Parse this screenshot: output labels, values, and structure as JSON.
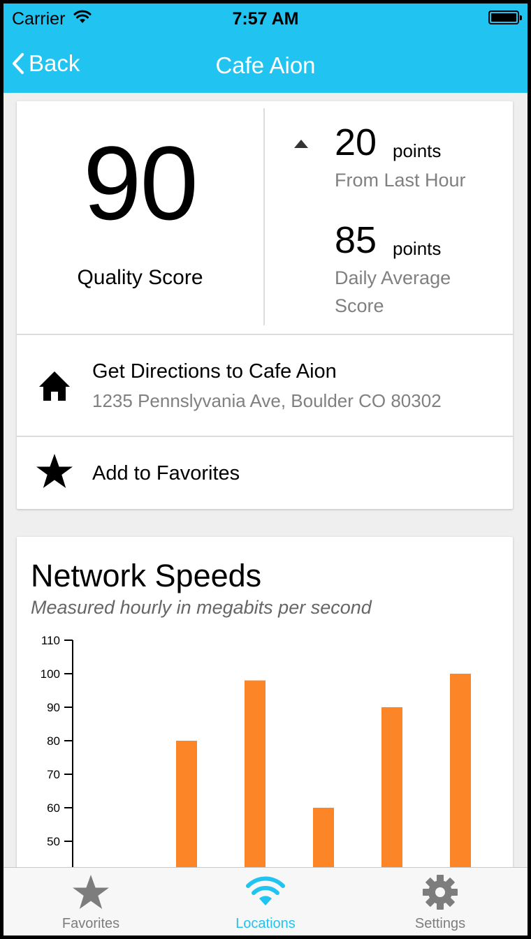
{
  "status_bar": {
    "carrier": "Carrier",
    "time": "7:57 AM"
  },
  "nav": {
    "back_label": "Back",
    "title": "Cafe Aion"
  },
  "score": {
    "value": "90",
    "label": "Quality Score",
    "change": {
      "value": "20",
      "unit": "points",
      "description": "From Last Hour",
      "direction": "up"
    },
    "average": {
      "value": "85",
      "unit": "points",
      "description": "Daily Average Score"
    }
  },
  "directions": {
    "title": "Get Directions to Cafe Aion",
    "address": "1235 Pennslyvania Ave, Boulder CO 80302",
    "icon": "home-icon"
  },
  "favorites": {
    "label": "Add to Favorites",
    "icon": "star-icon"
  },
  "network": {
    "title": "Network Speeds",
    "subtitle": "Measured hourly in megabits per second"
  },
  "chart_data": {
    "type": "bar",
    "title": "Network Speeds",
    "subtitle": "Measured hourly in megabits per second",
    "yticks": [
      50,
      60,
      70,
      80,
      90,
      100,
      110
    ],
    "ylim": [
      50,
      110
    ],
    "values": [
      null,
      80,
      98,
      60,
      90,
      100
    ],
    "bar_color": "#fc8528",
    "grid": false
  },
  "tabs": [
    {
      "label": "Favorites",
      "icon": "star-icon",
      "active": false
    },
    {
      "label": "Locations",
      "icon": "wifi-icon",
      "active": true
    },
    {
      "label": "Settings",
      "icon": "gear-icon",
      "active": false
    }
  ],
  "colors": {
    "accent": "#21c3f0",
    "bar": "#fc8528",
    "muted": "#808080"
  }
}
